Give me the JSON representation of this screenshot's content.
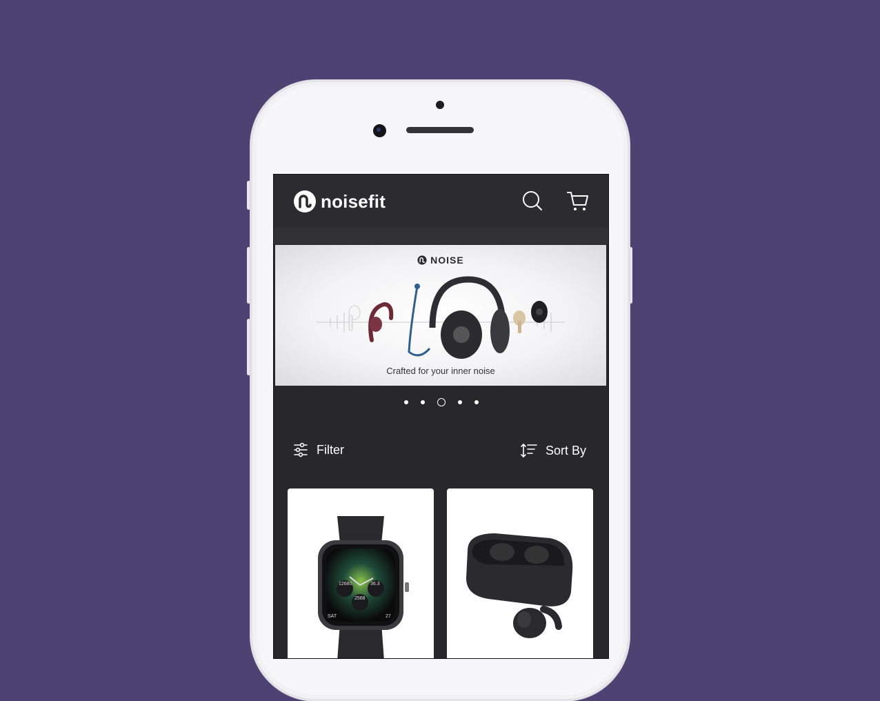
{
  "app": {
    "brand_name": "noisefit"
  },
  "header": {
    "search_icon": "search-icon",
    "cart_icon": "cart-icon"
  },
  "banner": {
    "brand": "NOISE",
    "tagline": "Crafted for your inner noise"
  },
  "carousel": {
    "slide_count": 5,
    "active_index": 2
  },
  "toolbar": {
    "filter_label": "Filter",
    "sort_label": "Sort By"
  },
  "products": [
    {
      "kind": "smartwatch",
      "face": {
        "left_value": "12680",
        "right_value": "36.3",
        "bottom_value": "2568",
        "day": "SAT",
        "date": "27"
      }
    },
    {
      "kind": "earbuds"
    }
  ],
  "colors": {
    "background": "#4d4373",
    "screen": "#28282c",
    "header": "#2b2b30",
    "text": "#ffffff"
  }
}
